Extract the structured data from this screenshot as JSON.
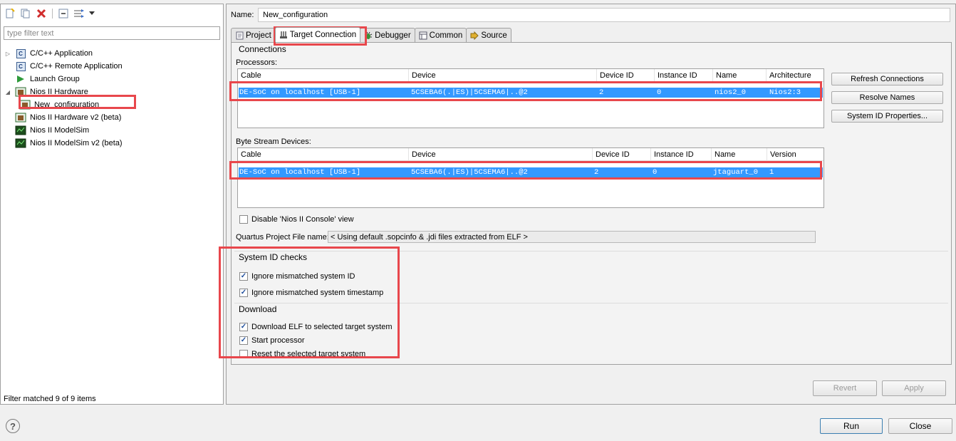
{
  "left": {
    "toolbar": {
      "icons": [
        "new-launch-configuration-icon",
        "duplicate-icon",
        "delete-icon",
        "collapse-all-icon",
        "filter-icon",
        "dropdown-arrow-icon"
      ]
    },
    "filter_placeholder": "type filter text",
    "tree": [
      {
        "label": "C/C++ Application",
        "icon": "c-icon",
        "level": 1
      },
      {
        "label": "C/C++ Remote Application",
        "icon": "c-icon",
        "level": 1
      },
      {
        "label": "Launch Group",
        "icon": "launch-group-icon",
        "level": 1
      },
      {
        "label": "Nios II Hardware",
        "icon": "nios-hardware-icon",
        "level": 1,
        "expanded": true
      },
      {
        "label": "New_configuration",
        "icon": "nios-config-icon",
        "level": 2,
        "selected": true
      },
      {
        "label": "Nios II Hardware v2 (beta)",
        "icon": "nios-hardware-icon",
        "level": 1
      },
      {
        "label": "Nios II ModelSim",
        "icon": "modelsim-icon",
        "level": 1
      },
      {
        "label": "Nios II ModelSim v2 (beta)",
        "icon": "modelsim-icon",
        "level": 1
      }
    ],
    "filter_status": "Filter matched 9 of 9 items"
  },
  "right": {
    "name_label": "Name:",
    "name_value": "New_configuration",
    "tabs": [
      {
        "label": "Project",
        "icon": "project-icon"
      },
      {
        "label": "Target Connection",
        "icon": "target-connection-icon",
        "active": true
      },
      {
        "label": "Debugger",
        "icon": "debugger-icon"
      },
      {
        "label": "Common",
        "icon": "common-icon"
      },
      {
        "label": "Source",
        "icon": "source-icon"
      }
    ],
    "connections": {
      "title": "Connections",
      "processors_label": "Processors:",
      "processors_headers": [
        "Cable",
        "Device",
        "Device ID",
        "Instance ID",
        "Name",
        "Architecture"
      ],
      "processors_row": [
        "DE-SoC on localhost [USB-1]",
        "5CSEBA6(.|ES)|5CSEMA6|..@2",
        "2",
        "0",
        "nios2_0",
        "Nios2:3"
      ],
      "byte_stream_label": "Byte Stream Devices:",
      "byte_headers": [
        "Cable",
        "Device",
        "Device ID",
        "Instance ID",
        "Name",
        "Version"
      ],
      "byte_row": [
        "DE-SoC on localhost [USB-1]",
        "5CSEBA6(.|ES)|5CSEMA6|..@2",
        "2",
        "0",
        "jtaguart_0",
        "1"
      ],
      "buttons": [
        "Refresh Connections",
        "Resolve Names",
        "System ID Properties..."
      ],
      "disable_console_label": "Disable 'Nios II Console' view",
      "disable_console_checked": false,
      "quartus_label": "Quartus Project File name:",
      "quartus_value": "< Using default .sopcinfo & .jdi files extracted from ELF >"
    },
    "system_id": {
      "title": "System ID checks",
      "items": [
        {
          "label": "Ignore mismatched system ID",
          "checked": true
        },
        {
          "label": "Ignore mismatched system timestamp",
          "checked": true
        }
      ]
    },
    "download": {
      "title": "Download",
      "items": [
        {
          "label": "Download ELF to selected target system",
          "checked": true
        },
        {
          "label": "Start processor",
          "checked": true
        },
        {
          "label": "Reset the selected target system",
          "checked": false
        }
      ]
    },
    "revert_label": "Revert",
    "apply_label": "Apply"
  },
  "bottom": {
    "help_icon": "help-icon",
    "help_glyph": "?",
    "run_label": "Run",
    "close_label": "Close"
  },
  "colors": {
    "selection": "#3399ff",
    "highlight_box": "#e8474c"
  }
}
